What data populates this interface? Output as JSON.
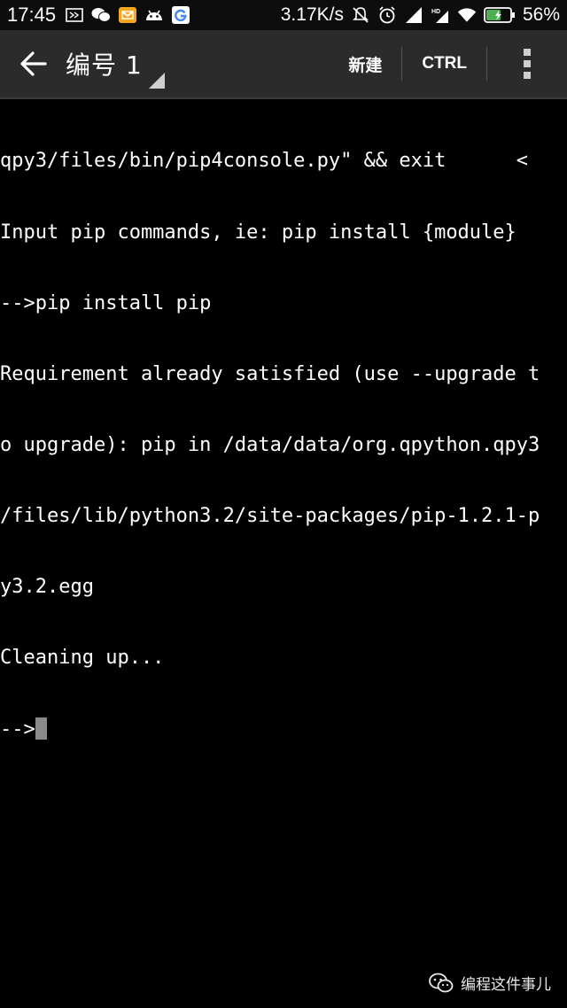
{
  "status_bar": {
    "time": "17:45",
    "network_speed": "3.17K/s",
    "battery_percent": "56%",
    "left_icons": [
      "screen-icon",
      "wechat-icon",
      "mail-icon",
      "android-icon",
      "google-icon"
    ],
    "right_icons": [
      "mute-icon",
      "alarm-icon",
      "signal-icon",
      "hd-signal-icon",
      "wifi-icon",
      "battery-icon"
    ]
  },
  "toolbar": {
    "title": "编号 1",
    "new_label": "新建",
    "ctrl_label": "CTRL"
  },
  "terminal": {
    "lines": [
      "qpy3/files/bin/pip4console.py\" && exit      <",
      "Input pip commands, ie: pip install {module}",
      "-->pip install pip",
      "Requirement already satisfied (use --upgrade t",
      "o upgrade): pip in /data/data/org.qpython.qpy3",
      "/files/lib/python3.2/site-packages/pip-1.2.1-p",
      "y3.2.egg",
      "Cleaning up..."
    ],
    "prompt": "-->"
  },
  "watermark": {
    "text": "编程这件事儿"
  },
  "colors": {
    "background": "#000000",
    "toolbar": "#2b2b2b",
    "text": "#ffffff",
    "cursor": "#8a8a8a",
    "battery_fill": "#4caf50"
  }
}
